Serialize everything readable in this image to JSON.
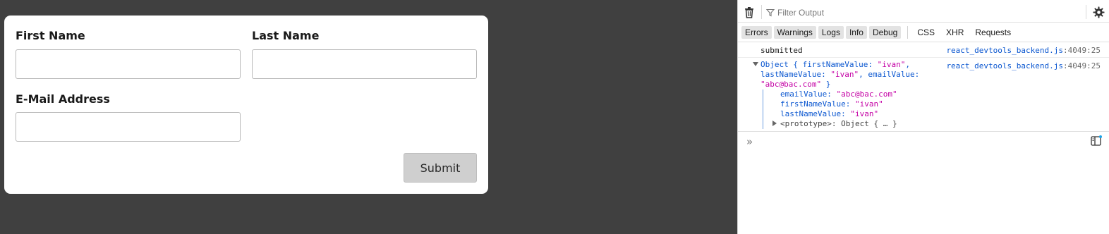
{
  "form": {
    "first_name_label": "First Name",
    "last_name_label": "Last Name",
    "email_label": "E-Mail Address",
    "first_name_value": "",
    "last_name_value": "",
    "email_value": "",
    "submit_label": "Submit"
  },
  "devtools": {
    "filter_placeholder": "Filter Output",
    "levels": [
      "Errors",
      "Warnings",
      "Logs",
      "Info",
      "Debug"
    ],
    "categories": [
      "CSS",
      "XHR",
      "Requests"
    ],
    "messages": [
      {
        "text": "submitted",
        "source": "react_devtools_backend.js",
        "location": ":4049:25"
      },
      {
        "source": "react_devtools_backend.js",
        "location": ":4049:25",
        "summary": {
          "prefix": "Object { firstNameValue: ",
          "first": "\"ivan\"",
          "mid1": ", lastNameValue: ",
          "last": "\"ivan\"",
          "mid2": ", emailValue: ",
          "email": "\"abc@bac.com\"",
          "suffix": " }"
        },
        "properties": [
          {
            "key": "emailValue",
            "value": "\"abc@bac.com\""
          },
          {
            "key": "firstNameValue",
            "value": "\"ivan\""
          },
          {
            "key": "lastNameValue",
            "value": "\"ivan\""
          }
        ],
        "prototype": "<prototype>: Object { … }"
      }
    ],
    "prompt_glyph": "»"
  },
  "colors": {
    "page_background": "#404040",
    "link_blue": "#0b57d0",
    "string_magenta": "#c400a5",
    "button_gray": "#cfcfcf"
  },
  "icons": [
    "trash-icon",
    "filter-icon",
    "gear-icon",
    "prompt-chevron-icon",
    "split-console-icon"
  ]
}
